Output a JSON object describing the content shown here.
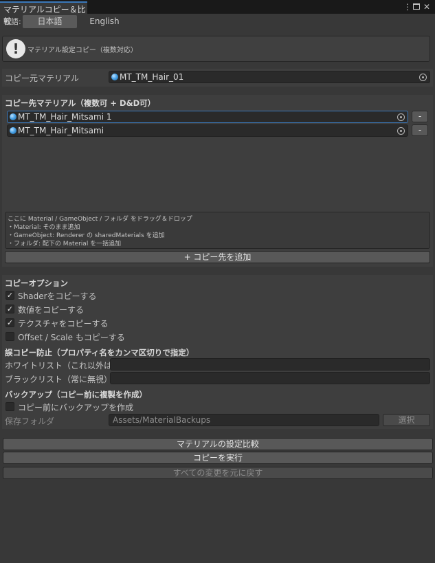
{
  "window": {
    "tab_title": "マテリアルコピー＆比較",
    "icons": [
      "more-icon",
      "maximize-icon",
      "close-icon"
    ]
  },
  "language": {
    "label": "言語:",
    "options": [
      "日本語",
      "English"
    ],
    "selected": "日本語"
  },
  "help": {
    "icon": "info-exclamation-icon",
    "text": "マテリアル設定コピー（複数対応）"
  },
  "source": {
    "label": "コピー元マテリアル",
    "value": "MT_TM_Hair_01"
  },
  "targets": {
    "header": "コピー先マテリアル（複数可 + D&D可）",
    "items": [
      {
        "value": "MT_TM_Hair_Mitsami 1",
        "remove_label": "-"
      },
      {
        "value": "MT_TM_Hair_Mitsami",
        "remove_label": "-"
      }
    ],
    "drop_hint": [
      "ここに Material / GameObject / フォルダ をドラッグ＆ドロップ",
      "・Material: そのまま追加",
      "・GameObject: Renderer の sharedMaterials を追加",
      "・フォルダ: 配下の Material を一括追加"
    ],
    "add_button": "+ コピー先を追加"
  },
  "options": {
    "header": "コピーオプション",
    "items": [
      {
        "label": "Shaderをコピーする",
        "checked": true
      },
      {
        "label": "数値をコピーする",
        "checked": true
      },
      {
        "label": "テクスチャをコピーする",
        "checked": true
      },
      {
        "label": "Offset / Scale もコピーする",
        "checked": false
      }
    ]
  },
  "protection": {
    "header": "誤コピー防止（プロパティ名をカンマ区切りで指定）",
    "whitelist_label": "ホワイトリスト（これ以外は無視",
    "whitelist_value": "",
    "blacklist_label": "ブラックリスト（常に無視）",
    "blacklist_value": ""
  },
  "backup": {
    "header": "バックアップ（コピー前に複製を作成）",
    "checkbox_label": "コピー前にバックアップを作成",
    "checked": false,
    "folder_label": "保存フォルダ",
    "folder_value": "Assets/MaterialBackups",
    "select_button": "選択"
  },
  "actions": {
    "compare": "マテリアルの設定比較",
    "execute": "コピーを実行",
    "revert": "すべての変更を元に戻す"
  },
  "colors": {
    "accent": "#3a79bb",
    "background": "#383838",
    "tabbar": "#191919"
  }
}
